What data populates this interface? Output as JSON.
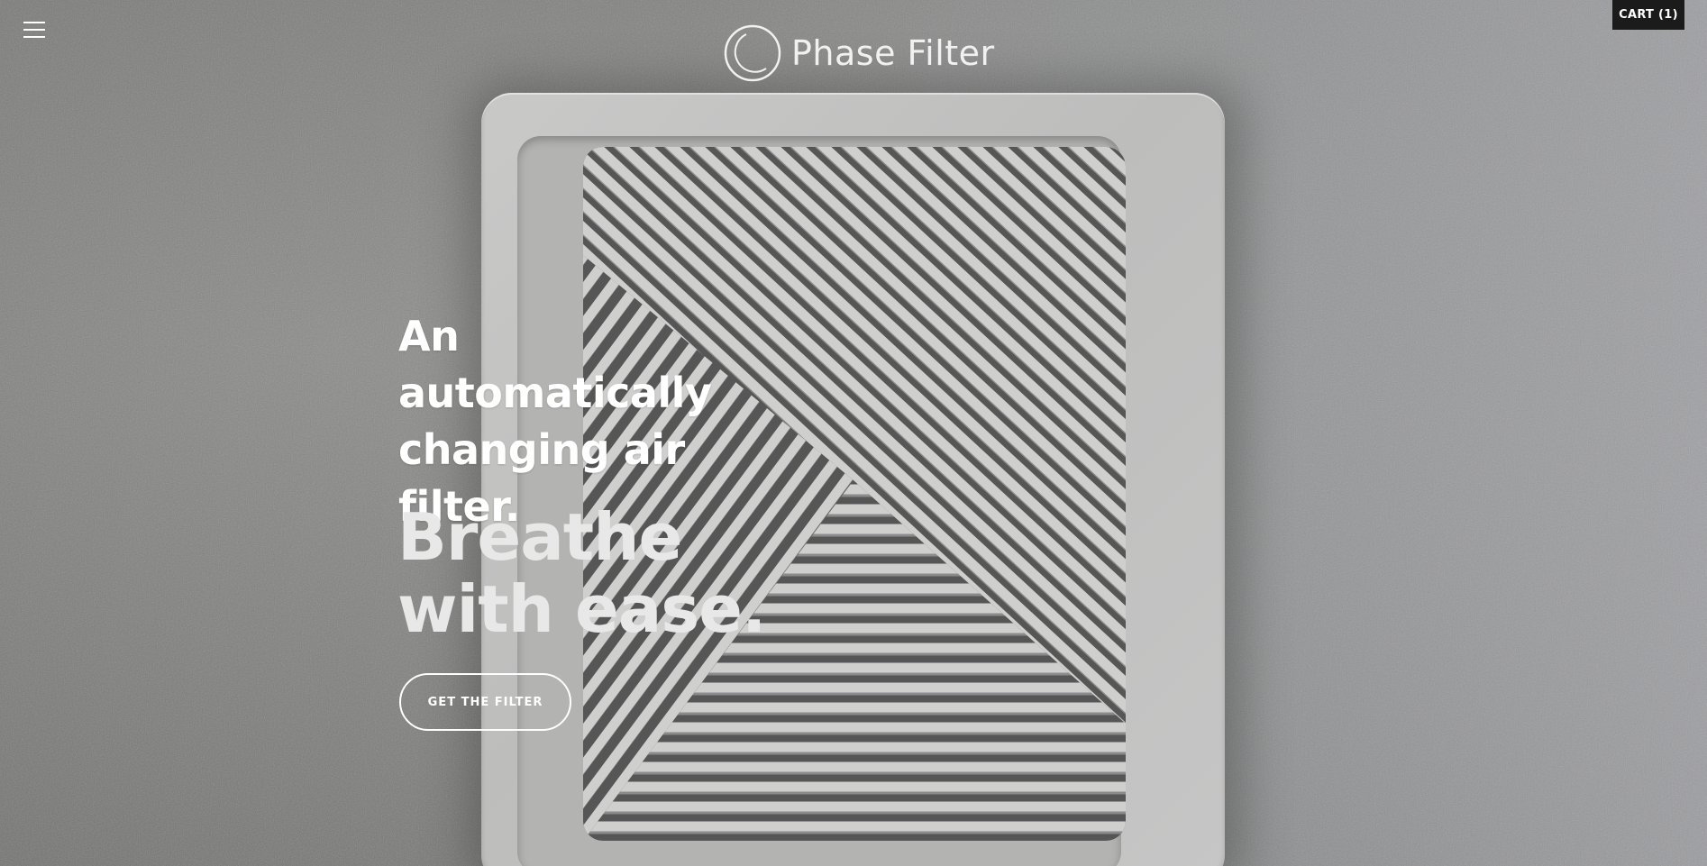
{
  "header": {
    "menu_icon": "hamburger-menu-icon",
    "logo_icon": "ring-logo-icon",
    "logo_text": "Phase Filter",
    "cart_label": "CART (1)"
  },
  "hero": {
    "headline": "An automatically changing air filter.",
    "tagline": "Breathe\nwith ease.",
    "cta_label": "GET THE FILTER",
    "background_image": "air vent grille on textured gray wall"
  },
  "colors": {
    "cart_background": "#1b1b1b",
    "text": "#ffffff",
    "wall": "#7d7e7b",
    "vent": "#c4c4c3"
  }
}
